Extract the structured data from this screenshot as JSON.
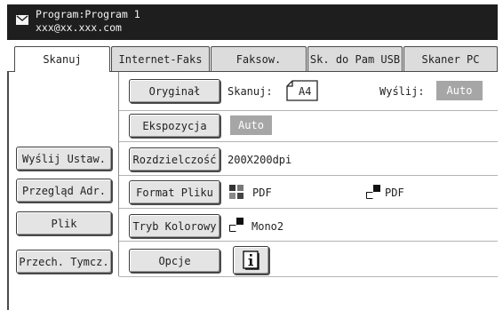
{
  "header": {
    "program": "Program:Program 1",
    "email": "xxx@xx.xxx.com"
  },
  "tabs": [
    {
      "label": "Skanuj",
      "active": true
    },
    {
      "label": "Internet-Faks",
      "active": false
    },
    {
      "label": "Faksow.",
      "active": false
    },
    {
      "label": "Sk. do Pam USB",
      "active": false
    },
    {
      "label": "Skaner PC",
      "active": false
    }
  ],
  "sidebar": {
    "send_settings": "Wyślij Ustaw.",
    "address_review": "Przegląd Adr.",
    "file": "Plik",
    "temp_storage": "Przech. Tymcz."
  },
  "settings": {
    "original": {
      "button": "Oryginał",
      "scan_label": "Skanuj:",
      "scan_size": "A4",
      "send_label": "Wyślij:",
      "send_value": "Auto"
    },
    "exposure": {
      "button": "Ekspozycja",
      "value": "Auto"
    },
    "resolution": {
      "button": "Rozdzielczość",
      "value": "200X200dpi"
    },
    "file_format": {
      "button": "Format Pliku",
      "value_color": "PDF",
      "value_bw": "PDF"
    },
    "color_mode": {
      "button": "Tryb Kolorowy",
      "value": "Mono2"
    },
    "options": {
      "button": "Opcje"
    }
  }
}
